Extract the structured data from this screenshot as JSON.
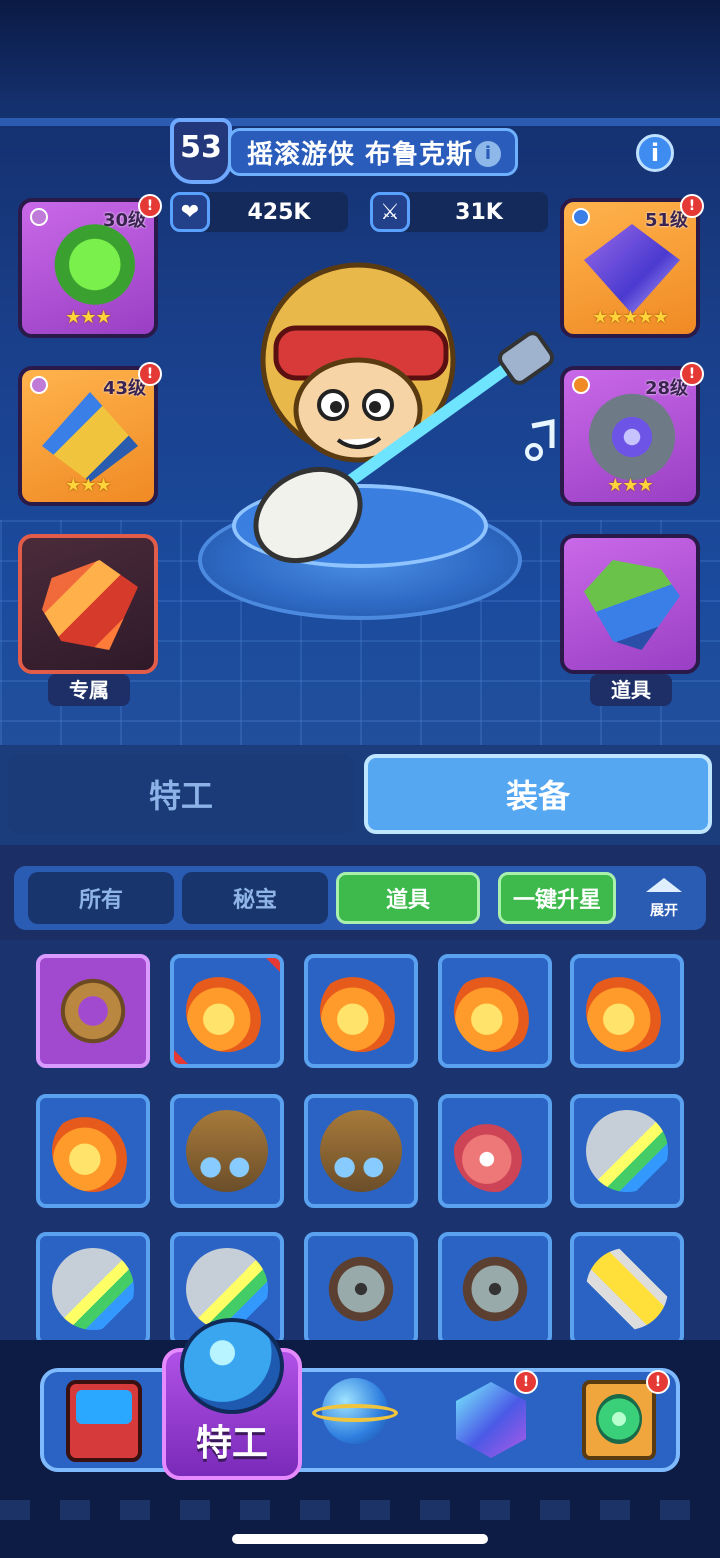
{
  "hero": {
    "level": "53",
    "name": "摇滚游侠 布鲁克斯",
    "hp": "425K",
    "attack": "31K"
  },
  "left_slots": [
    {
      "level": "30级",
      "stars": "★★★",
      "color": "purple"
    },
    {
      "level": "43级",
      "stars": "★★★",
      "color": "orange"
    },
    {
      "label": "专属",
      "color": "red"
    }
  ],
  "right_slots": [
    {
      "level": "51级",
      "stars": "★★★★★",
      "color": "orange"
    },
    {
      "level": "28级",
      "stars": "★★★",
      "color": "purple"
    },
    {
      "label": "道具",
      "color": "purple"
    }
  ],
  "tabs": {
    "agent": "特工",
    "equipment": "装备",
    "selected": "装备"
  },
  "filters": {
    "all": "所有",
    "secret": "秘宝",
    "items": "道具",
    "one_click_star": "一键升星",
    "expand": "展开",
    "selected": "道具"
  },
  "inventory": [
    {
      "icon": "ring-icon",
      "selected": true
    },
    {
      "icon": "meteor-icon"
    },
    {
      "icon": "meteor-icon"
    },
    {
      "icon": "meteor-icon"
    },
    {
      "icon": "meteor-icon"
    },
    {
      "icon": "meteor-icon"
    },
    {
      "icon": "drone-icon"
    },
    {
      "icon": "drone-icon"
    },
    {
      "icon": "blower-icon"
    },
    {
      "icon": "jet-icon"
    },
    {
      "icon": "jet-icon"
    },
    {
      "icon": "jet-icon"
    },
    {
      "icon": "gatling-icon"
    },
    {
      "icon": "gatling-icon"
    },
    {
      "icon": "tube-icon"
    }
  ],
  "bottom_nav": {
    "active_label": "特工",
    "items": [
      "arcade-icon",
      "agent-helmet-icon",
      "planet-icon",
      "cube-icon",
      "portal-icon"
    ]
  },
  "colors": {
    "purple": "#b154d8",
    "orange": "#f49a32",
    "accent_blue": "#2a63c4",
    "green": "#3dba4b",
    "alert_red": "#e53935"
  }
}
